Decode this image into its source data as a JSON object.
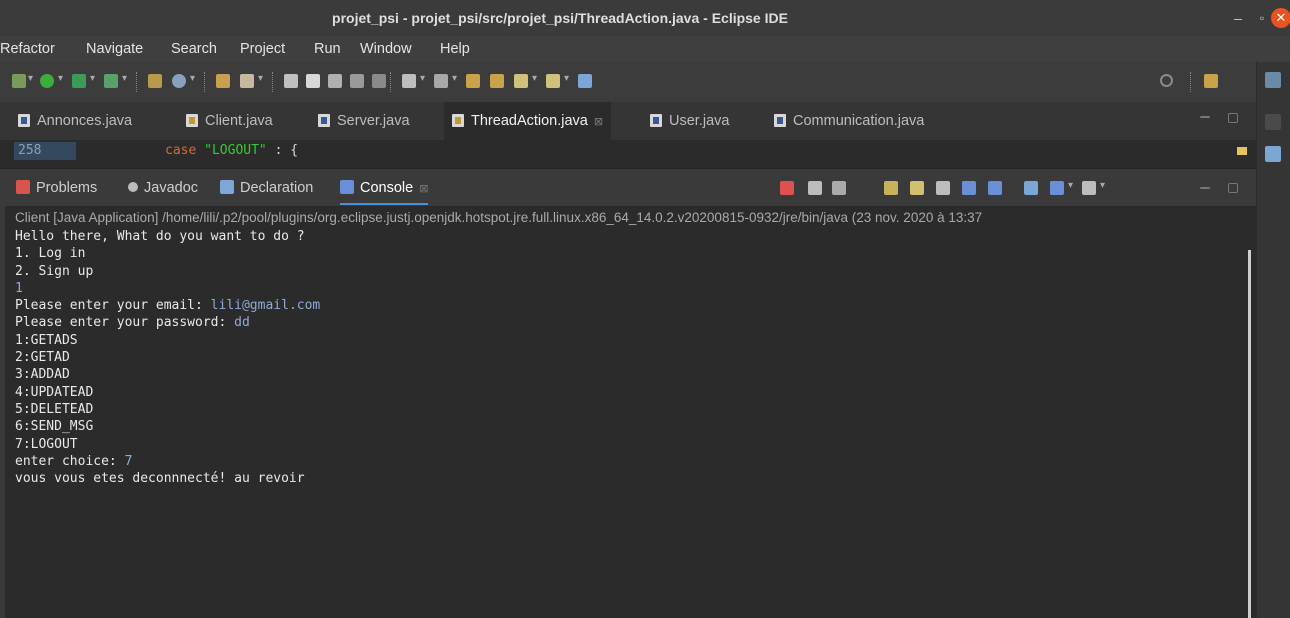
{
  "window": {
    "title": "projet_psi - projet_psi/src/projet_psi/ThreadAction.java - Eclipse IDE",
    "min_label": "–",
    "max_label": "▫",
    "close_label": "✕"
  },
  "menu": [
    "Refactor",
    "Navigate",
    "Search",
    "Project",
    "Run",
    "Window",
    "Help"
  ],
  "editor_tabs": [
    {
      "label": "Annonces.java",
      "active": false
    },
    {
      "label": "Client.java",
      "active": false
    },
    {
      "label": "Server.java",
      "active": false
    },
    {
      "label": "ThreadAction.java",
      "active": true
    },
    {
      "label": "User.java",
      "active": false
    },
    {
      "label": "Communication.java",
      "active": false
    }
  ],
  "editor": {
    "line_number": "258",
    "code_keyword": "case",
    "code_string": "\"LOGOUT\"",
    "code_rest": " : {"
  },
  "panel_tabs": [
    {
      "label": "Problems",
      "icon": "problems-icon",
      "color": "#d9534f"
    },
    {
      "label": "Javadoc",
      "icon": "javadoc-icon",
      "color": "#bbbbbb"
    },
    {
      "label": "Declaration",
      "icon": "declaration-icon",
      "color": "#7fa6d9"
    },
    {
      "label": "Console",
      "icon": "console-icon",
      "color": "#6b8fd6",
      "active": true
    }
  ],
  "console": {
    "header": "Client [Java Application] /home/lili/.p2/pool/plugins/org.eclipse.justj.openjdk.hotspot.jre.full.linux.x86_64_14.0.2.v20200815-0932/jre/bin/java  (23 nov. 2020 à 13:37",
    "lines": [
      {
        "text": "Hello there, What do you want to do ?"
      },
      {
        "text": "1. Log in"
      },
      {
        "text": "2. Sign up"
      },
      {
        "text": "",
        "input": "1"
      },
      {
        "text": "Please enter your email: ",
        "input": "lili@gmail.com"
      },
      {
        "text": "Please enter your password: ",
        "input": "dd"
      },
      {
        "text": "1:GETADS"
      },
      {
        "text": "2:GETAD"
      },
      {
        "text": "3:ADDAD"
      },
      {
        "text": "4:UPDATEAD"
      },
      {
        "text": "5:DELETEAD"
      },
      {
        "text": "6:SEND_MSG"
      },
      {
        "text": "7:LOGOUT"
      },
      {
        "text": "enter choice: ",
        "input": "7"
      },
      {
        "text": "vous vous etes deconnnecté! au revoir"
      }
    ]
  },
  "colors": {
    "input_text": "#8fa9d8",
    "accent": "#4a90d9",
    "close_button": "#e95420"
  }
}
